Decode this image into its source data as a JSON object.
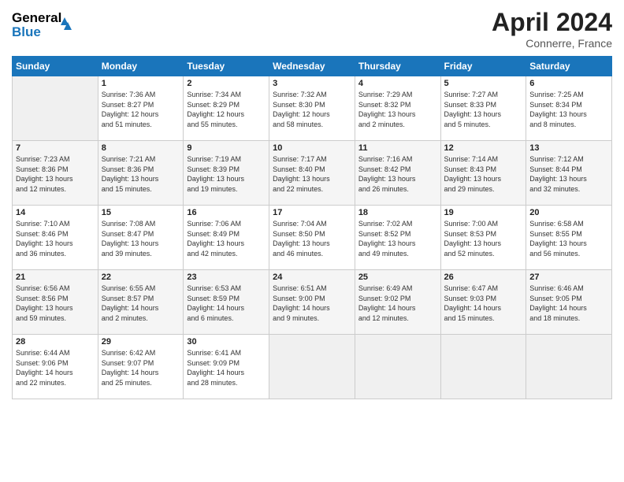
{
  "header": {
    "logo_line1": "General",
    "logo_line2": "Blue",
    "month_title": "April 2024",
    "location": "Connerre, France"
  },
  "days_of_week": [
    "Sunday",
    "Monday",
    "Tuesday",
    "Wednesday",
    "Thursday",
    "Friday",
    "Saturday"
  ],
  "weeks": [
    [
      {
        "day": "",
        "info": ""
      },
      {
        "day": "1",
        "info": "Sunrise: 7:36 AM\nSunset: 8:27 PM\nDaylight: 12 hours\nand 51 minutes."
      },
      {
        "day": "2",
        "info": "Sunrise: 7:34 AM\nSunset: 8:29 PM\nDaylight: 12 hours\nand 55 minutes."
      },
      {
        "day": "3",
        "info": "Sunrise: 7:32 AM\nSunset: 8:30 PM\nDaylight: 12 hours\nand 58 minutes."
      },
      {
        "day": "4",
        "info": "Sunrise: 7:29 AM\nSunset: 8:32 PM\nDaylight: 13 hours\nand 2 minutes."
      },
      {
        "day": "5",
        "info": "Sunrise: 7:27 AM\nSunset: 8:33 PM\nDaylight: 13 hours\nand 5 minutes."
      },
      {
        "day": "6",
        "info": "Sunrise: 7:25 AM\nSunset: 8:34 PM\nDaylight: 13 hours\nand 8 minutes."
      }
    ],
    [
      {
        "day": "7",
        "info": ""
      },
      {
        "day": "8",
        "info": "Sunrise: 7:21 AM\nSunset: 8:36 PM\nDaylight: 13 hours\nand 15 minutes."
      },
      {
        "day": "9",
        "info": "Sunrise: 7:19 AM\nSunset: 8:39 PM\nDaylight: 13 hours\nand 19 minutes."
      },
      {
        "day": "10",
        "info": "Sunrise: 7:17 AM\nSunset: 8:40 PM\nDaylight: 13 hours\nand 22 minutes."
      },
      {
        "day": "11",
        "info": "Sunrise: 7:16 AM\nSunset: 8:42 PM\nDaylight: 13 hours\nand 26 minutes."
      },
      {
        "day": "12",
        "info": "Sunrise: 7:14 AM\nSunset: 8:43 PM\nDaylight: 13 hours\nand 29 minutes."
      },
      {
        "day": "13",
        "info": "Sunrise: 7:12 AM\nSunset: 8:44 PM\nDaylight: 13 hours\nand 32 minutes."
      }
    ],
    [
      {
        "day": "14",
        "info": ""
      },
      {
        "day": "15",
        "info": "Sunrise: 7:08 AM\nSunset: 8:47 PM\nDaylight: 13 hours\nand 39 minutes."
      },
      {
        "day": "16",
        "info": "Sunrise: 7:06 AM\nSunset: 8:49 PM\nDaylight: 13 hours\nand 42 minutes."
      },
      {
        "day": "17",
        "info": "Sunrise: 7:04 AM\nSunset: 8:50 PM\nDaylight: 13 hours\nand 46 minutes."
      },
      {
        "day": "18",
        "info": "Sunrise: 7:02 AM\nSunset: 8:52 PM\nDaylight: 13 hours\nand 49 minutes."
      },
      {
        "day": "19",
        "info": "Sunrise: 7:00 AM\nSunset: 8:53 PM\nDaylight: 13 hours\nand 52 minutes."
      },
      {
        "day": "20",
        "info": "Sunrise: 6:58 AM\nSunset: 8:55 PM\nDaylight: 13 hours\nand 56 minutes."
      }
    ],
    [
      {
        "day": "21",
        "info": ""
      },
      {
        "day": "22",
        "info": "Sunrise: 6:55 AM\nSunset: 8:57 PM\nDaylight: 14 hours\nand 2 minutes."
      },
      {
        "day": "23",
        "info": "Sunrise: 6:53 AM\nSunset: 8:59 PM\nDaylight: 14 hours\nand 6 minutes."
      },
      {
        "day": "24",
        "info": "Sunrise: 6:51 AM\nSunset: 9:00 PM\nDaylight: 14 hours\nand 9 minutes."
      },
      {
        "day": "25",
        "info": "Sunrise: 6:49 AM\nSunset: 9:02 PM\nDaylight: 14 hours\nand 12 minutes."
      },
      {
        "day": "26",
        "info": "Sunrise: 6:47 AM\nSunset: 9:03 PM\nDaylight: 14 hours\nand 15 minutes."
      },
      {
        "day": "27",
        "info": "Sunrise: 6:46 AM\nSunset: 9:05 PM\nDaylight: 14 hours\nand 18 minutes."
      }
    ],
    [
      {
        "day": "28",
        "info": "Sunrise: 6:44 AM\nSunset: 9:06 PM\nDaylight: 14 hours\nand 22 minutes."
      },
      {
        "day": "29",
        "info": "Sunrise: 6:42 AM\nSunset: 9:07 PM\nDaylight: 14 hours\nand 25 minutes."
      },
      {
        "day": "30",
        "info": "Sunrise: 6:41 AM\nSunset: 9:09 PM\nDaylight: 14 hours\nand 28 minutes."
      },
      {
        "day": "",
        "info": ""
      },
      {
        "day": "",
        "info": ""
      },
      {
        "day": "",
        "info": ""
      },
      {
        "day": "",
        "info": ""
      }
    ]
  ],
  "week_sunday_info": [
    "Sunrise: 7:23 AM\nSunset: 8:36 PM\nDaylight: 13 hours\nand 12 minutes.",
    "Sunrise: 7:10 AM\nSunset: 8:46 PM\nDaylight: 13 hours\nand 36 minutes.",
    "Sunrise: 6:56 AM\nSunset: 8:56 PM\nDaylight: 13 hours\nand 59 minutes."
  ]
}
